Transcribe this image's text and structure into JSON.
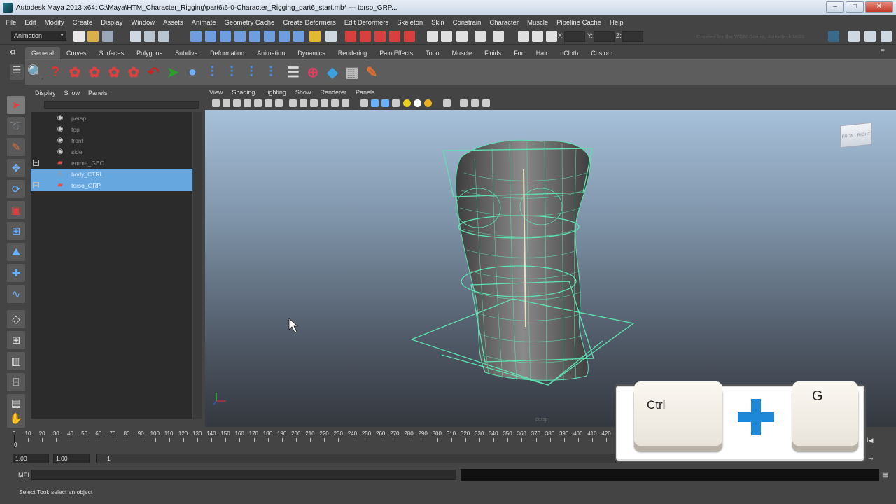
{
  "window": {
    "title": "Autodesk Maya 2013 x64: C:\\Maya\\HTM_Character_Rigging\\part6\\6-0-Character_Rigging_part6_start.mb*   ---   torso_GRP...",
    "controls": [
      "–",
      "□",
      "✕"
    ]
  },
  "menubar": [
    "File",
    "Edit",
    "Modify",
    "Create",
    "Display",
    "Window",
    "Assets",
    "Animate",
    "Geometry Cache",
    "Create Deformers",
    "Edit Deformers",
    "Skeleton",
    "Skin",
    "Constrain",
    "Character",
    "Muscle",
    "Pipeline Cache",
    "Help"
  ],
  "statusline": {
    "mode": "Animation",
    "x_label": "X:",
    "y_label": "Y:",
    "z_label": "Z:",
    "credit": "Created by the WDM Group, Autodesk MGS"
  },
  "shelf": {
    "tabs": [
      "General",
      "Curves",
      "Surfaces",
      "Polygons",
      "Subdivs",
      "Deformation",
      "Animation",
      "Dynamics",
      "Rendering",
      "PaintEffects",
      "Toon",
      "Muscle",
      "Fluids",
      "Fur",
      "Hair",
      "nCloth",
      "Custom"
    ],
    "active_tab": "General"
  },
  "outliner": {
    "menu": [
      "Display",
      "Show",
      "Panels"
    ],
    "items": [
      {
        "label": "persp",
        "icon": "camera-icon",
        "selected": false,
        "expandable": false
      },
      {
        "label": "top",
        "icon": "camera-icon",
        "selected": false,
        "expandable": false
      },
      {
        "label": "front",
        "icon": "camera-icon",
        "selected": false,
        "expandable": false
      },
      {
        "label": "side",
        "icon": "camera-icon",
        "selected": false,
        "expandable": false
      },
      {
        "label": "emma_GEO",
        "icon": "transform-icon",
        "selected": false,
        "expandable": true
      },
      {
        "label": "body_CTRL",
        "icon": "curve-icon",
        "selected": true,
        "expandable": false
      },
      {
        "label": "torso_GRP",
        "icon": "transform-icon",
        "selected": true,
        "expandable": true
      }
    ]
  },
  "viewport": {
    "menu": [
      "View",
      "Shading",
      "Lighting",
      "Show",
      "Renderer",
      "Panels"
    ],
    "camera_label": "persp",
    "viewcube_label": "FRONT  RIGHT"
  },
  "timeline": {
    "ticks": [
      0,
      10,
      20,
      30,
      40,
      50,
      60,
      70,
      80,
      90,
      100,
      110,
      120,
      130,
      140,
      150,
      160,
      170,
      180,
      190,
      200,
      210,
      220,
      230,
      240,
      250,
      260,
      270,
      280,
      290,
      300,
      310,
      320,
      330,
      340,
      350,
      360,
      370,
      380,
      390,
      400,
      410,
      420
    ],
    "current_frame": "0",
    "range_start": "1.00",
    "range_start2": "1.00",
    "range_inner": "1"
  },
  "command_line": {
    "label": "MEL"
  },
  "help_line": "Select Tool: select an object",
  "shortcut_overlay": {
    "key1": "Ctrl",
    "key2": "G"
  },
  "colors": {
    "selection": "#67a7e0",
    "wireframe": "#5fe0b0",
    "accent_plus": "#1e88d8"
  }
}
